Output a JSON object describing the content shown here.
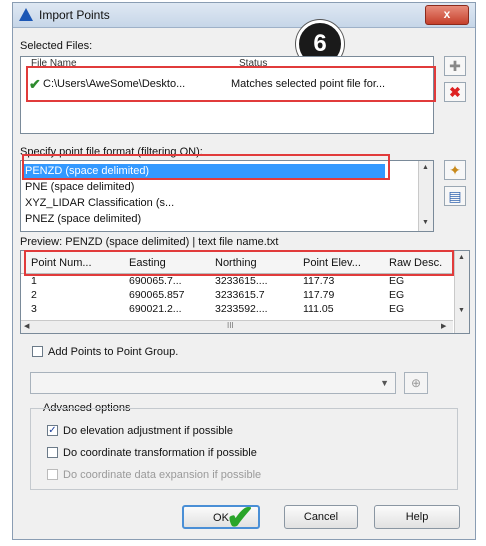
{
  "window": {
    "title": "Import Points",
    "close_label": "x"
  },
  "step_badge": "6",
  "selected_files": {
    "label": "Selected Files:",
    "columns": [
      "File Name",
      "Status"
    ],
    "rows": [
      {
        "file": "C:\\Users\\AweSome\\Deskto...",
        "status": "Matches selected point file for..."
      }
    ]
  },
  "format": {
    "label": "Specify point file format (filtering ON):",
    "items": [
      "PENZD (space delimited)",
      "PNE (space delimited)",
      "XYZ_LIDAR Classification (s...",
      "PNEZ (space delimited)"
    ],
    "selected": "PENZD (space delimited)"
  },
  "preview": {
    "label": "Preview: PENZD (space delimited) | text file name.txt",
    "columns": [
      "Point Num...",
      "Easting",
      "Northing",
      "Point Elev...",
      "Raw Desc."
    ],
    "rows": [
      [
        "1",
        "690065.7...",
        "3233615....",
        "117.73",
        "EG"
      ],
      [
        "2",
        "690065.857",
        "3233615.7",
        "117.79",
        "EG"
      ],
      [
        "3",
        "690021.2...",
        "3233592....",
        "111.05",
        "EG"
      ]
    ],
    "scroll_mark": "III"
  },
  "add_to_group": {
    "label": "Add Points to Point Group.",
    "checked": false
  },
  "advanced": {
    "label": "Advanced options",
    "options": [
      {
        "label": "Do elevation adjustment if possible",
        "checked": true
      },
      {
        "label": "Do coordinate transformation if possible",
        "checked": false
      },
      {
        "label": "Do coordinate data expansion if possible",
        "checked": false,
        "disabled": true
      }
    ]
  },
  "buttons": {
    "ok": "OK",
    "cancel": "Cancel",
    "help": "Help"
  },
  "colors": {
    "highlight": "#e13b3b",
    "selection": "#3399ff",
    "check": "#2aa52a"
  }
}
